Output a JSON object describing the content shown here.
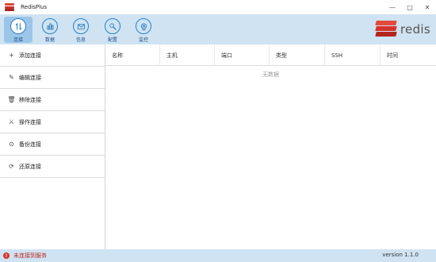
{
  "app": {
    "title": "RedisPlus"
  },
  "window": {
    "minimize": "—",
    "maximize": "□",
    "close": "✕"
  },
  "toolbar": {
    "items": [
      {
        "label": "连接",
        "icon": "connect-icon"
      },
      {
        "label": "数据",
        "icon": "data-icon"
      },
      {
        "label": "信息",
        "icon": "mail-icon"
      },
      {
        "label": "配置",
        "icon": "wrench-icon"
      },
      {
        "label": "监控",
        "icon": "monitor-icon"
      }
    ],
    "active": "连接"
  },
  "brand": {
    "name": "redis"
  },
  "sidebar": {
    "items": [
      {
        "label": "添加连接",
        "icon": "+"
      },
      {
        "label": "编辑连接",
        "icon": "✎"
      },
      {
        "label": "移除连接",
        "icon": "🗑"
      },
      {
        "label": "操作连接",
        "icon": "⚔"
      },
      {
        "label": "备份连接",
        "icon": "⊙"
      },
      {
        "label": "还原连接",
        "icon": "⟳"
      }
    ]
  },
  "table": {
    "columns": [
      "名称",
      "主机",
      "端口",
      "类型",
      "SSH",
      "时间"
    ],
    "empty_text": "无数据"
  },
  "status": {
    "message": "未连接到服务",
    "version": "version 1.1.0"
  },
  "colors": {
    "toolbar_bg": "#cfe3f2",
    "accent": "#2f7fc2",
    "error": "#d9302a",
    "brand_red": "#d6332b"
  }
}
